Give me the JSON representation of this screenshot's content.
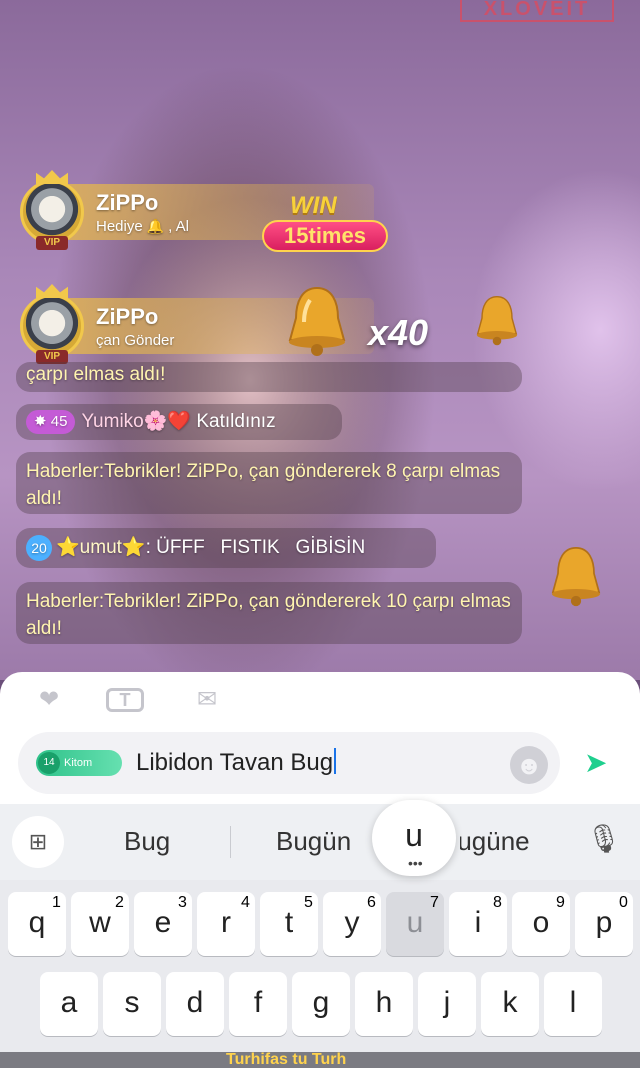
{
  "watermark": "XLOVEIT",
  "banners": [
    {
      "name": "ZiPPo",
      "sub_before": "Hediye",
      "sub_after": ", Al",
      "vip": "VIP"
    },
    {
      "name": "ZiPPo",
      "sub": "çan Gönder",
      "vip": "VIP"
    }
  ],
  "win": {
    "word": "WIN",
    "times": "15times"
  },
  "multiplier": "x40",
  "chat": [
    {
      "id": "partial",
      "text": "çarpı elmas aldı!"
    },
    {
      "id": "join",
      "level": "45",
      "name": "Yumiko",
      "text": "Katıldınız"
    },
    {
      "id": "news1",
      "text": "Haberler:Tebrikler! ZiPPo, çan göndererek 8 çarpı elmas aldı!"
    },
    {
      "id": "umut",
      "level": "20",
      "name": "umut",
      "text": ": ÜFFF   FISTIK   GİBİSİN"
    },
    {
      "id": "news2",
      "text": "Haberler:Tebrikler! ZiPPo, çan göndererek 10 çarpı elmas aldı!"
    }
  ],
  "input": {
    "value": "Libidon Tavan Bug",
    "tag_level": "14",
    "tag_label": "Kitom"
  },
  "suggestions": [
    "Bug",
    "Bugün",
    "Bugüne"
  ],
  "key_popup": "u",
  "keyboard": {
    "row1": [
      {
        "k": "q",
        "h": "1"
      },
      {
        "k": "w",
        "h": "2"
      },
      {
        "k": "e",
        "h": "3"
      },
      {
        "k": "r",
        "h": "4"
      },
      {
        "k": "t",
        "h": "5"
      },
      {
        "k": "y",
        "h": "6"
      },
      {
        "k": "u",
        "h": "7"
      },
      {
        "k": "i",
        "h": "8"
      },
      {
        "k": "o",
        "h": "9"
      },
      {
        "k": "p",
        "h": "0"
      }
    ],
    "row2": [
      "a",
      "s",
      "d",
      "f",
      "g",
      "h",
      "j",
      "k",
      "l"
    ]
  },
  "footer_ticker": "Turhifas tu  Turh"
}
